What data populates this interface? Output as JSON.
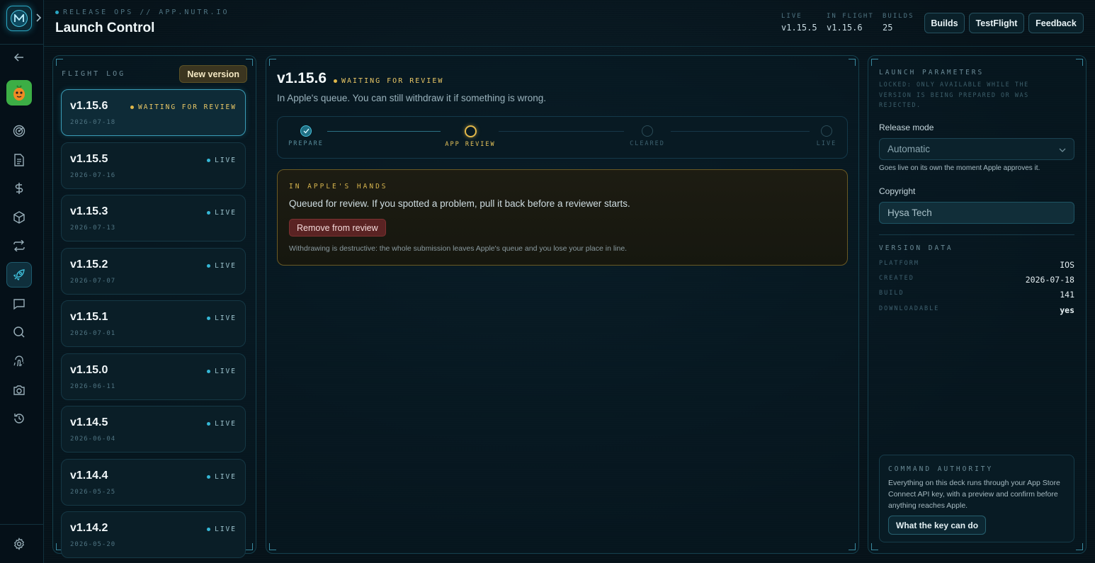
{
  "header": {
    "eyebrow": "RELEASE OPS // APP.NUTR.IO",
    "title": "Launch Control",
    "stats": [
      {
        "key": "LIVE",
        "value": "v1.15.5"
      },
      {
        "key": "IN FLIGHT",
        "value": "v1.15.6"
      },
      {
        "key": "BUILDS",
        "value": "25"
      }
    ],
    "buttons": {
      "builds": "Builds",
      "testflight": "TestFlight",
      "feedback": "Feedback"
    }
  },
  "rail": {
    "icons": [
      "back-arrow-icon",
      "app-avatar",
      "radar-icon",
      "document-icon",
      "dollar-icon",
      "box-icon",
      "repeat-icon",
      "rocket-icon",
      "chat-icon",
      "search-icon",
      "fingerprint-icon",
      "camera-icon",
      "history-icon",
      "settings-icon"
    ],
    "active": "rocket-icon"
  },
  "flight_log": {
    "title": "FLIGHT LOG",
    "new_version_label": "New version",
    "versions": [
      {
        "version": "v1.15.6",
        "date": "2026-07-18",
        "status": "WAITING FOR REVIEW",
        "status_color": "#e0b84a"
      },
      {
        "version": "v1.15.5",
        "date": "2026-07-16",
        "status": "LIVE",
        "status_color": "#35b7d6"
      },
      {
        "version": "v1.15.3",
        "date": "2026-07-13",
        "status": "LIVE",
        "status_color": "#35b7d6"
      },
      {
        "version": "v1.15.2",
        "date": "2026-07-07",
        "status": "LIVE",
        "status_color": "#35b7d6"
      },
      {
        "version": "v1.15.1",
        "date": "2026-07-01",
        "status": "LIVE",
        "status_color": "#35b7d6"
      },
      {
        "version": "v1.15.0",
        "date": "2026-06-11",
        "status": "LIVE",
        "status_color": "#35b7d6"
      },
      {
        "version": "v1.14.5",
        "date": "2026-06-04",
        "status": "LIVE",
        "status_color": "#35b7d6"
      },
      {
        "version": "v1.14.4",
        "date": "2026-05-25",
        "status": "LIVE",
        "status_color": "#35b7d6"
      },
      {
        "version": "v1.14.2",
        "date": "2026-05-20",
        "status": "LIVE",
        "status_color": "#35b7d6"
      }
    ]
  },
  "detail": {
    "version": "v1.15.6",
    "status": "WAITING FOR REVIEW",
    "subtitle": "In Apple's queue. You can still withdraw it if something is wrong.",
    "steps": [
      {
        "label": "PREPARE",
        "state": "done"
      },
      {
        "label": "APP REVIEW",
        "state": "current"
      },
      {
        "label": "CLEARED",
        "state": "pending"
      },
      {
        "label": "LIVE",
        "state": "pending"
      }
    ],
    "hands": {
      "title": "IN APPLE'S HANDS",
      "text": "Queued for review. If you spotted a problem, pull it back before a reviewer starts.",
      "button": "Remove from review",
      "warning": "Withdrawing is destructive: the whole submission leaves Apple's queue and you lose your place in line."
    }
  },
  "params": {
    "title": "LAUNCH PARAMETERS",
    "lock_note": "LOCKED: ONLY AVAILABLE WHILE THE VERSION IS BEING PREPARED OR WAS REJECTED.",
    "release_mode_label": "Release mode",
    "release_mode_value": "Automatic",
    "release_mode_hint": "Goes live on its own the moment Apple approves it.",
    "copyright_label": "Copyright",
    "copyright_value": "Hysa Tech",
    "version_data_title": "VERSION DATA",
    "version_data": [
      {
        "key": "PLATFORM",
        "value": "IOS"
      },
      {
        "key": "CREATED",
        "value": "2026-07-18"
      },
      {
        "key": "BUILD",
        "value": "141"
      },
      {
        "key": "DOWNLOADABLE",
        "value": "yes"
      }
    ],
    "command": {
      "title": "COMMAND AUTHORITY",
      "text": "Everything on this deck runs through your App Store Connect API key, with a preview and confirm before anything reaches Apple.",
      "button": "What the key can do"
    }
  }
}
